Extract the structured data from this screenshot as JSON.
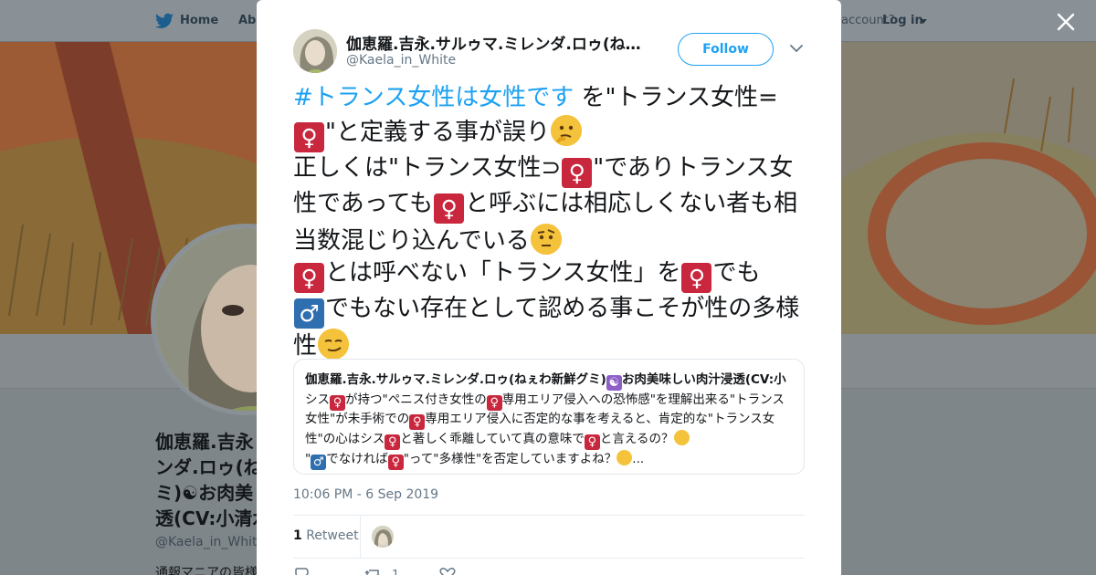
{
  "nav": {
    "home_label": "Home",
    "about_label": "Abo",
    "account_prompt": "account?",
    "login_label": "Log in"
  },
  "background_profile": {
    "name_line1": "伽恵羅.吉永",
    "name_line2": "ンダ.ロゥ(ね",
    "name_line3": "ミ)☯お肉美",
    "name_line4": "透(CV:小清水",
    "handle": "@Kaela_in_White",
    "bio": "通報マニアの皆様"
  },
  "tweet": {
    "display_name": "伽恵羅.吉永.サルゥマ.ミレンダ.ロゥ(ねぇわ新鮮グミ)☯お肉美味しい肉汁浸透(CV:小清水亜美)",
    "handle": "@Kaela_in_White",
    "follow_label": "Follow",
    "hashtag": "#トランス女性は女性です",
    "segments": {
      "s1": " を\"トランス女性=",
      "s2": "\"と定義する事が誤り",
      "s3": "正しくは\"トランス女性⊃",
      "s4": "\"でありトランス女性であっても",
      "s5": "と呼ぶには相応しくない者も相当数混じり込んでいる",
      "s6": "とは呼べない「トランス女性」を",
      "s7": "でも",
      "s8": "でもない存在として認める事こそが性の多様性"
    },
    "female_symbol": "♀",
    "male_symbol": "♂",
    "timestamp": "10:06 PM - 6 Sep 2019",
    "retweet_count": "1",
    "retweet_label": "Retweet",
    "like_count": "1"
  },
  "quote": {
    "author": "伽恵羅.吉永.サルゥマ.ミレンダ.ロゥ(ねぇわ新鮮グミ)",
    "author_tail": "お肉美味しい肉汁浸透(CV:小",
    "yin_symbol": "☯",
    "q1": "シス",
    "q2": "が持つ\"ペニス付き女性の",
    "q3": "専用エリア侵入への恐怖感\"を理解出来る\"トランス女性\"が未手術での",
    "q4": "専用エリア侵入に否定的な事を考えると、肯定的な\"トランス女性\"の心はシス",
    "q5": "と著しく乖離していて真の意味で",
    "q6": "と言えるの？",
    "q7": "\"",
    "q8": "でなければ",
    "q9": "\"って\"多様性\"を否定していますよね？",
    "q10": "..."
  },
  "colors": {
    "accent": "#1da1f2",
    "female_emoji": "#c9273e",
    "male_emoji": "#2f6fb0"
  }
}
